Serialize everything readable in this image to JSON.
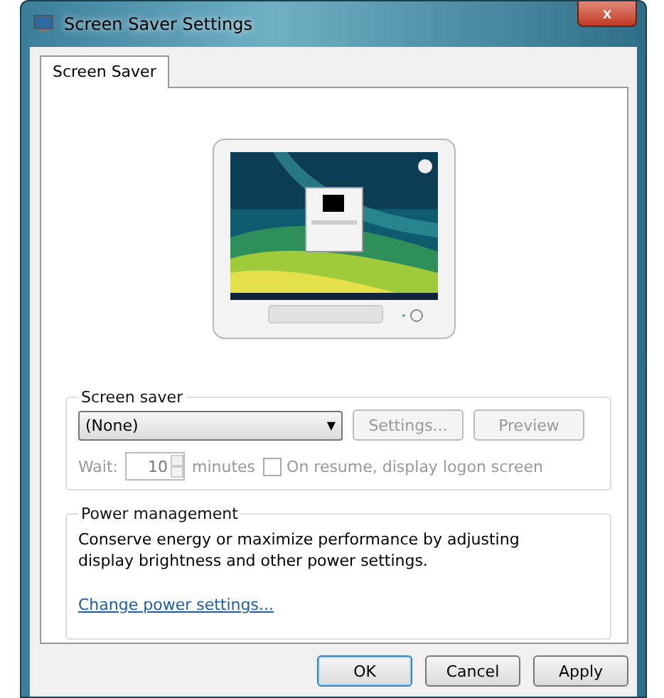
{
  "window": {
    "title": "Screen Saver Settings",
    "close_glyph": "x"
  },
  "tabs": [
    {
      "label": "Screen Saver",
      "selected": true
    }
  ],
  "screen_saver": {
    "legend": "Screen saver",
    "dropdown": {
      "value": "(None)",
      "glyph": "▼"
    },
    "buttons": [
      {
        "label": "Settings...",
        "disabled": true
      },
      {
        "label": "Preview",
        "disabled": true
      }
    ],
    "wait": {
      "label": "Wait:",
      "value": "10",
      "unit": "minutes",
      "disabled": true
    },
    "resume_checkbox": {
      "label": "On resume, display logon screen",
      "checked": false,
      "disabled": true
    }
  },
  "power": {
    "legend": "Power management",
    "text": "Conserve energy or maximize performance by adjusting display brightness and other power settings.",
    "link": "Change power settings..."
  },
  "buttons": [
    {
      "label": "OK",
      "default": true
    },
    {
      "label": "Cancel",
      "default": false
    },
    {
      "label": "Apply",
      "default": false
    }
  ]
}
